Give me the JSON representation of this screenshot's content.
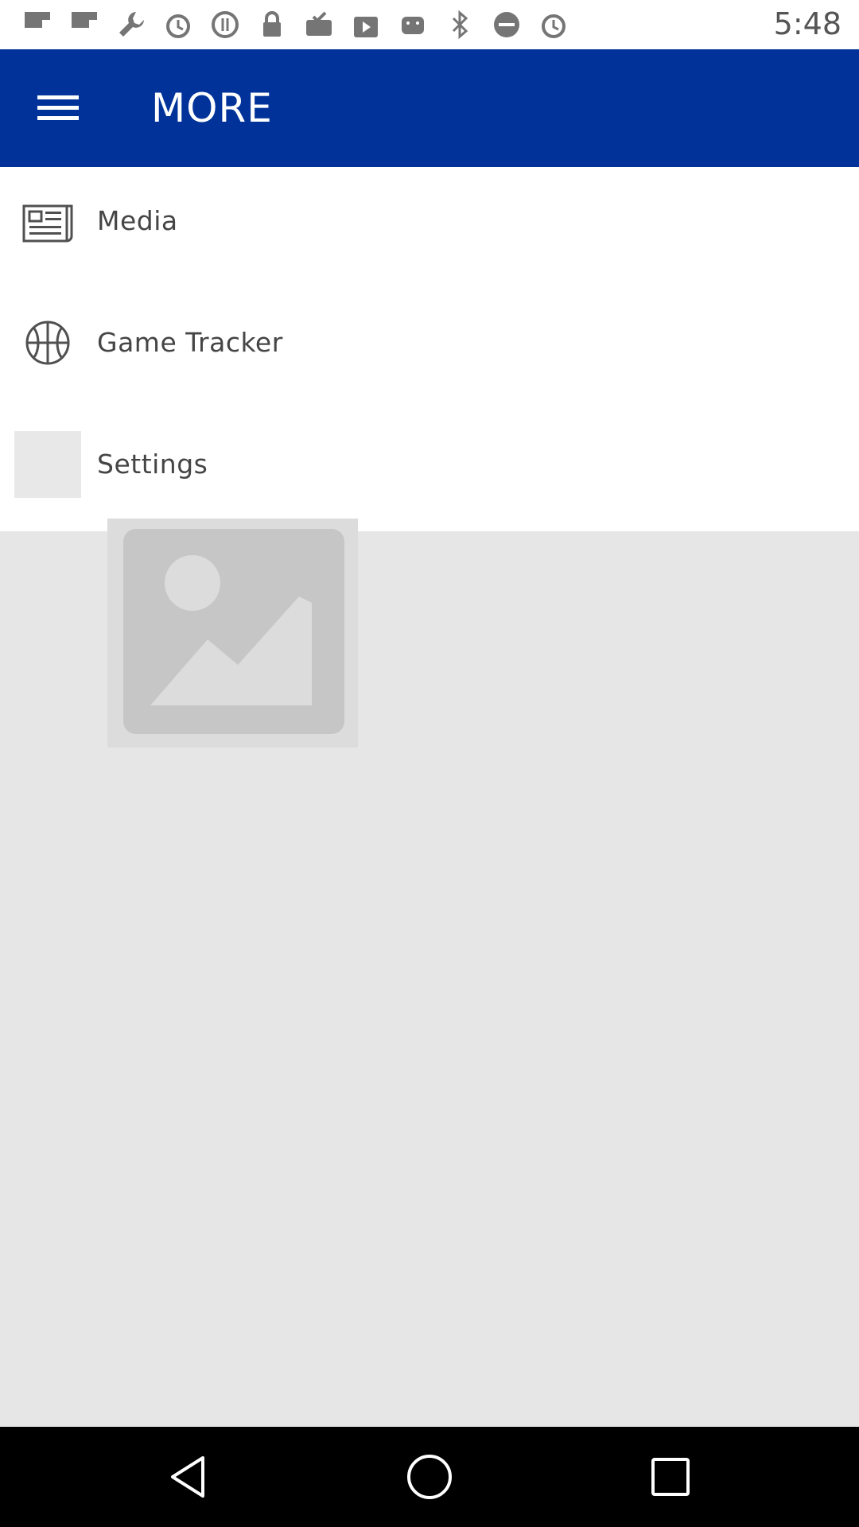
{
  "status_bar": {
    "time": "5:48",
    "icons": [
      "flipboard-icon",
      "flipboard-icon",
      "wrench-icon",
      "alarm-icon",
      "block-icon",
      "lock-icon",
      "inbox-check-icon",
      "play-store-icon",
      "android-icon",
      "bluetooth-icon",
      "do-not-disturb-icon",
      "alarm-icon"
    ]
  },
  "app_bar": {
    "title": "MORE",
    "color": "#003299"
  },
  "menu": {
    "items": [
      {
        "label": "Media",
        "icon": "newspaper-icon"
      },
      {
        "label": "Game Tracker",
        "icon": "basketball-icon"
      },
      {
        "label": "Settings",
        "icon": "settings-placeholder"
      }
    ]
  },
  "content": {
    "image_placeholder": "image-placeholder-icon"
  },
  "nav_bar": {
    "buttons": [
      "back-icon",
      "home-icon",
      "recents-icon"
    ]
  }
}
